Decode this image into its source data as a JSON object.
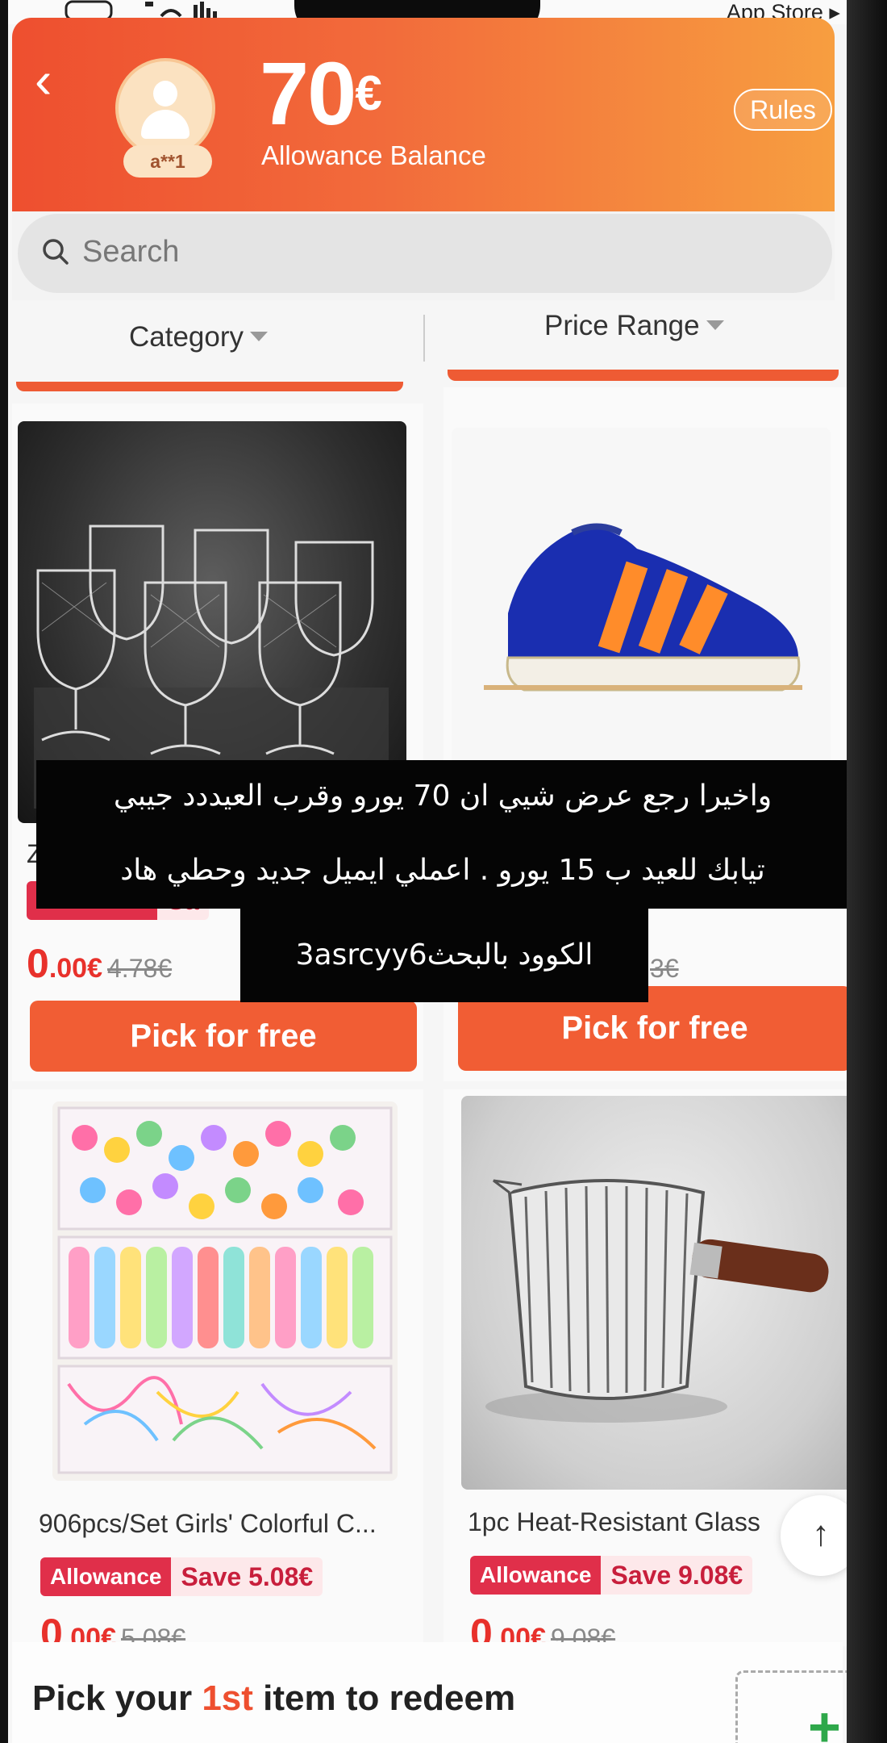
{
  "status_bar": {
    "back_to": "App Store ▸"
  },
  "header": {
    "user_tag": "a**1",
    "balance_value": "70",
    "balance_currency": "€",
    "balance_label": "Allowance Balance",
    "rules_label": "Rules",
    "back_icon": "chevron-left-icon"
  },
  "search": {
    "placeholder": "Search"
  },
  "filters": {
    "category": "Category",
    "price_range": "Price Range"
  },
  "products": [
    {
      "title": "Za",
      "badge_a": "Allowance",
      "badge_b": "Sa",
      "price_int": "0",
      "price_dec": ".00€",
      "old_price": "4.78€",
      "button": "Pick for free"
    },
    {
      "title": "",
      "badge_a": "",
      "badge_b": "",
      "price_int": "",
      "price_dec": "",
      "old_price": "3€",
      "button": "Pick for free"
    },
    {
      "title": "906pcs/Set Girls' Colorful C...",
      "badge_a": "Allowance",
      "badge_b": "Save 5.08€",
      "price_int": "0",
      "price_dec": ".00€",
      "old_price": "5.08€"
    },
    {
      "title": "1pc Heat-Resistant Glass",
      "badge_a": "Allowance",
      "badge_b": "Save 9.08€",
      "price_int": "0",
      "price_dec": ".00€",
      "old_price": "9.08€"
    }
  ],
  "caption": {
    "line1": "واخيرا رجع عرض شيي ان 70 يورو وقرب العيددد جيبي",
    "line2": "تيابك للعيد ب 15 يورو . اعملي ايميل جديد وحطي هاد",
    "line3": "الكوود بالبحث3asrcyy6"
  },
  "redeem": {
    "prefix": "Pick your ",
    "highlight": "1st",
    "suffix": " item to redeem"
  },
  "colors": {
    "accent": "#ee4f2f",
    "allowance_badge": "#e02f4a",
    "price": "#e8312b"
  }
}
